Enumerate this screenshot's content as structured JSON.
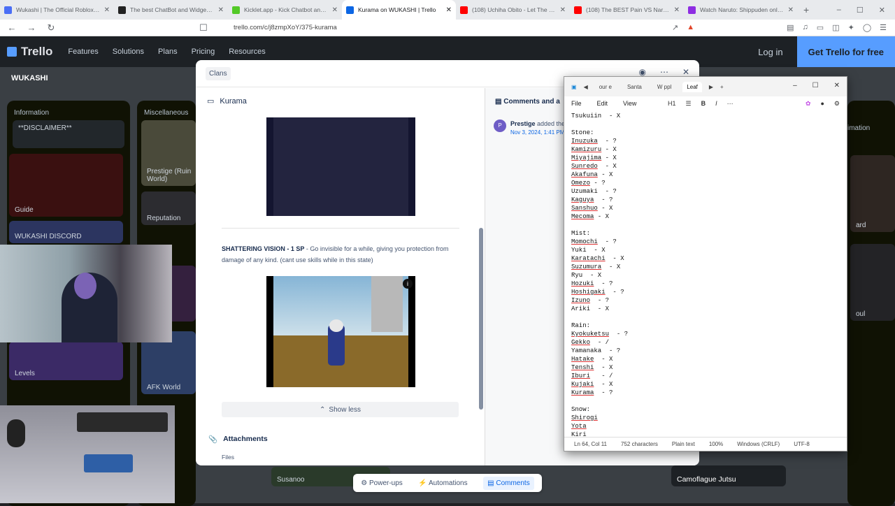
{
  "browser": {
    "tabs": [
      {
        "title": "Wukashi | The Official Roblox Websi",
        "color": "#4a6ef5"
      },
      {
        "title": "The best ChatBot and Widgets for Ki",
        "color": "#222222"
      },
      {
        "title": "Kicklet.app - Kick Chatbot and Over",
        "color": "#53c927"
      },
      {
        "title": "Kurama on WUKASHI | Trello",
        "color": "#0c66e4",
        "active": true
      },
      {
        "title": "(108) Uchiha Obito - Let The World",
        "color": "#ff0000"
      },
      {
        "title": "(108) The BEST Pain VS Naruto Edit",
        "color": "#ff0000"
      },
      {
        "title": "Watch Naruto: Shippuden online fre",
        "color": "#8e2de2"
      }
    ],
    "url": "trello.com/c/j8zmpXoY/375-kurama"
  },
  "trello": {
    "logo": "Trello",
    "menu": [
      "Features",
      "Solutions",
      "Plans",
      "Pricing",
      "Resources"
    ],
    "login": "Log in",
    "get_free": "Get Trello for free",
    "board_name": "WUKASHI",
    "lists": {
      "information": {
        "title": "Information",
        "disclaimer": "**DISCLAIMER**",
        "guide": "Guide",
        "discord": "WUKASHI DISCORD",
        "levels": "Levels"
      },
      "misc": {
        "title": "Miscellaneous",
        "prestige": "Prestige (Ruin World)",
        "reputation": "Reputation",
        "afk": "AFK World",
        "realm": "ealm"
      },
      "right_cards": {
        "imation": "imation",
        "ard": "ard",
        "oul": "oul",
        "camo": "Camoflague Jutsu",
        "susanoo": "Susanoo"
      }
    }
  },
  "card": {
    "label": "Clans",
    "title": "Kurama",
    "skill_name": "SHATTERING VISION - 1 SP",
    "skill_desc": " - Go invisible for a while, giving you protection from damage of any kind. (cant use skills while in this state)",
    "show_less": "Show less",
    "attachments": "Attachments",
    "files": "Files",
    "comments_header": "Comments and a",
    "activity_user": "Prestige",
    "activity_text": " added the",
    "activity_date": "Nov 3, 2024, 1:41 PM",
    "avatar_letter": "P"
  },
  "bottom_bar": [
    "Power-ups",
    "Automations",
    "Comments"
  ],
  "notepad": {
    "tabs": [
      "our e",
      "Santa",
      "W ppl",
      "Leaf"
    ],
    "menu": [
      "File",
      "Edit",
      "View"
    ],
    "heading": "H1",
    "status": [
      "Ln 64, Col 11",
      "752 characters",
      "Plain text",
      "100%",
      "Windows (CRLF)",
      "UTF-8"
    ],
    "lines": [
      {
        "text": "Tsukuiin  - X",
        "u": false
      },
      {
        "text": "",
        "u": false
      },
      {
        "text": "Stone:",
        "u": false
      },
      {
        "text": "Inuzuka",
        "rest": "  - ?",
        "u": true
      },
      {
        "text": "Kamizuru",
        "rest": " - X",
        "u": true
      },
      {
        "text": "Miyajima",
        "rest": " - X",
        "u": true
      },
      {
        "text": "Sunredo",
        "rest": "  - X",
        "u": true
      },
      {
        "text": "Akafuna",
        "rest": " - X",
        "u": true
      },
      {
        "text": "Omezo",
        "rest": " - ?",
        "u": true
      },
      {
        "text": "Uzumaki  - ?",
        "u": false
      },
      {
        "text": "Kaguya",
        "rest": "  - ?",
        "u": true
      },
      {
        "text": "Sanshuo",
        "rest": " - X",
        "u": true
      },
      {
        "text": "Mecoma",
        "rest": " - X",
        "u": true
      },
      {
        "text": "",
        "u": false
      },
      {
        "text": "Mist:",
        "u": false
      },
      {
        "text": "Momochi",
        "rest": "  - ?",
        "u": true
      },
      {
        "text": "Yuki  - X",
        "u": false
      },
      {
        "text": "Karatachi",
        "rest": "  - X",
        "u": true
      },
      {
        "text": "Suzumura",
        "rest": "  - X",
        "u": true
      },
      {
        "text": "Ryu  - X",
        "u": false
      },
      {
        "text": "Hozuki",
        "rest": "  - ?",
        "u": true
      },
      {
        "text": "Hoshigaki",
        "rest": "  - ?",
        "u": true
      },
      {
        "text": "Izuno",
        "rest": "  - ?",
        "u": true
      },
      {
        "text": "Ariki  - X",
        "u": false
      },
      {
        "text": "",
        "u": false
      },
      {
        "text": "Rain:",
        "u": false
      },
      {
        "text": "Kyokuketsu",
        "rest": "  - ?",
        "u": true
      },
      {
        "text": "Gekko",
        "rest": "  - /",
        "u": true
      },
      {
        "text": "Yamanaka  - ?",
        "u": false
      },
      {
        "text": "Hatake",
        "rest": "  - X",
        "u": true
      },
      {
        "text": "Tenshi",
        "rest": "  - X",
        "u": true
      },
      {
        "text": "Iburi",
        "rest": "   - /",
        "u": true
      },
      {
        "text": "Kujaki",
        "rest": "  - X",
        "u": true
      },
      {
        "text": "Kurama",
        "rest": "  - ?",
        "u": true
      },
      {
        "text": "",
        "u": false
      },
      {
        "text": "Snow:",
        "u": false
      },
      {
        "text": "Shirogi",
        "rest": "",
        "u": true
      },
      {
        "text": "Yota",
        "rest": "",
        "u": true
      },
      {
        "text": "Kiri",
        "rest": "",
        "u": false
      }
    ]
  }
}
